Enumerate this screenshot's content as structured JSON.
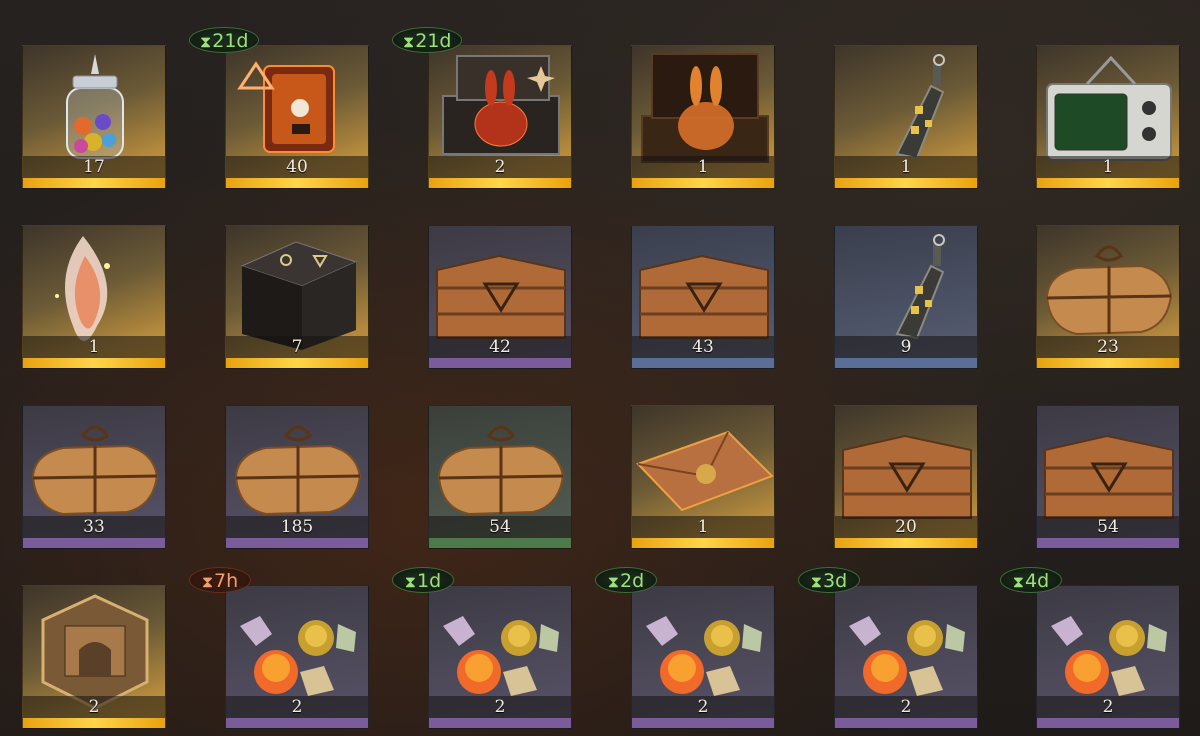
{
  "inventory": {
    "rows": [
      [
        {
          "item": "marble-jar",
          "count": "17",
          "rarity": "gold",
          "timer": ""
        },
        {
          "item": "rune-book",
          "count": "40",
          "rarity": "gold",
          "timer": "21d"
        },
        {
          "item": "bunny-case",
          "count": "2",
          "rarity": "gold",
          "timer": "21d"
        },
        {
          "item": "bunny-chest",
          "count": "1",
          "rarity": "gold",
          "timer": ""
        },
        {
          "item": "message-bottle",
          "count": "1",
          "rarity": "gold",
          "timer": ""
        },
        {
          "item": "radio-device",
          "count": "1",
          "rarity": "gold",
          "timer": ""
        }
      ],
      [
        {
          "item": "spirit-flame",
          "count": "1",
          "rarity": "gold",
          "timer": ""
        },
        {
          "item": "rune-block",
          "count": "7",
          "rarity": "gold",
          "timer": ""
        },
        {
          "item": "wooden-crate",
          "count": "42",
          "rarity": "purple",
          "timer": ""
        },
        {
          "item": "wooden-crate",
          "count": "43",
          "rarity": "blue",
          "timer": ""
        },
        {
          "item": "message-bottle",
          "count": "9",
          "rarity": "blue",
          "timer": ""
        },
        {
          "item": "parcel",
          "count": "23",
          "rarity": "gold",
          "timer": ""
        }
      ],
      [
        {
          "item": "parcel",
          "count": "33",
          "rarity": "purple",
          "timer": ""
        },
        {
          "item": "parcel",
          "count": "185",
          "rarity": "purple",
          "timer": ""
        },
        {
          "item": "parcel",
          "count": "54",
          "rarity": "green",
          "timer": ""
        },
        {
          "item": "sealed-envelope",
          "count": "1",
          "rarity": "gold",
          "timer": ""
        },
        {
          "item": "wooden-crate",
          "count": "20",
          "rarity": "gold",
          "timer": ""
        },
        {
          "item": "wooden-crate",
          "count": "54",
          "rarity": "purple",
          "timer": ""
        }
      ],
      [
        {
          "item": "puzzle-box",
          "count": "2",
          "rarity": "gold",
          "timer": ""
        },
        {
          "item": "candies",
          "count": "2",
          "rarity": "purple",
          "timer": "7h"
        },
        {
          "item": "candies",
          "count": "2",
          "rarity": "purple",
          "timer": "1d"
        },
        {
          "item": "candies",
          "count": "2",
          "rarity": "purple",
          "timer": "2d"
        },
        {
          "item": "candies",
          "count": "2",
          "rarity": "purple",
          "timer": "3d"
        },
        {
          "item": "candies",
          "count": "2",
          "rarity": "purple",
          "timer": "4d"
        }
      ]
    ]
  },
  "timer_icon": "hourglass-icon",
  "timer_glyph": "⧗",
  "colors": {
    "gold": "#e8a210",
    "blue": "#5a6f98",
    "purple": "#7a5c9a",
    "green": "#4e7a4a",
    "timer_green": "#9ee07a",
    "timer_orange": "#f0a070"
  }
}
